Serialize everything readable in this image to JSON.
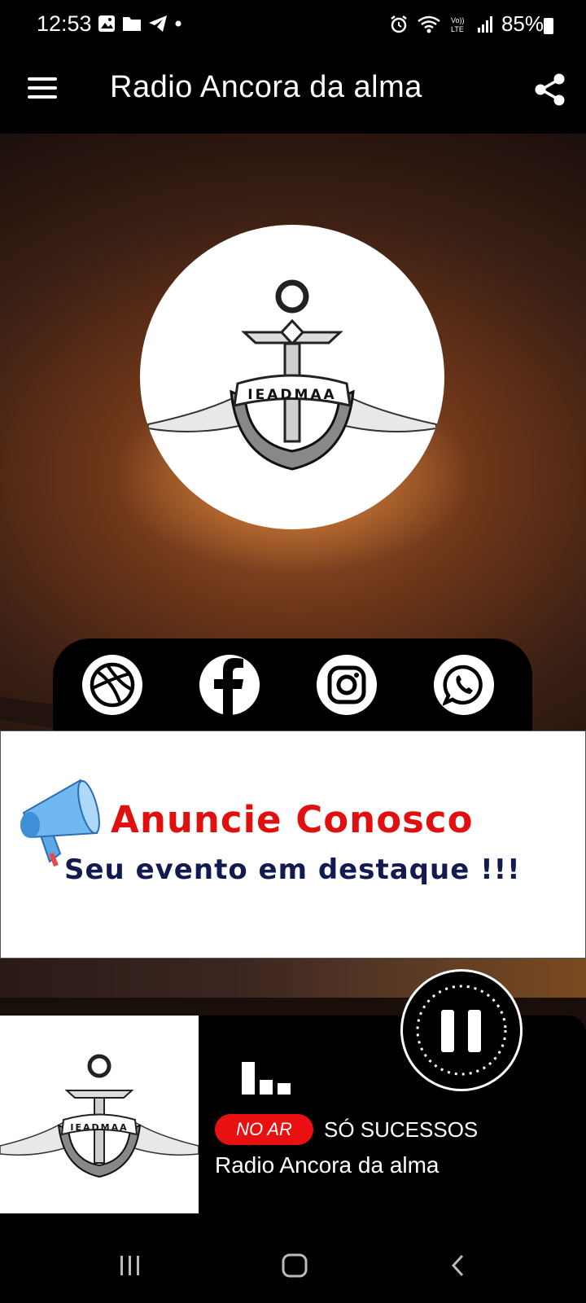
{
  "status_bar": {
    "time": "12:53",
    "battery": "85%",
    "icons": [
      "gallery-icon",
      "folder-icon",
      "telegram-icon",
      "dot-icon",
      "alarm-icon",
      "wifi-icon",
      "volte-icon",
      "signal-icon",
      "battery-icon"
    ]
  },
  "app_bar": {
    "title": "Radio Ancora da alma",
    "menu_icon": "hamburger-menu-icon",
    "share_icon": "share-icon"
  },
  "logo": {
    "text": "IEADMAA"
  },
  "social": {
    "items": [
      "dribbble-icon",
      "facebook-icon",
      "instagram-icon",
      "whatsapp-icon"
    ]
  },
  "ad_banner": {
    "title": "Anuncie Conosco",
    "subtitle": "Seu evento em destaque !!!",
    "title_color": "#e01010",
    "subtitle_color": "#121a50"
  },
  "player": {
    "badge": "NO AR",
    "genre": "SÓ SUCESSOS",
    "station": "Radio Ancora da alma",
    "badge_color": "#e81010",
    "art_text": "IEADMAA"
  },
  "nav_bar": {
    "items": [
      "recent-apps-icon",
      "home-icon",
      "back-icon"
    ]
  }
}
